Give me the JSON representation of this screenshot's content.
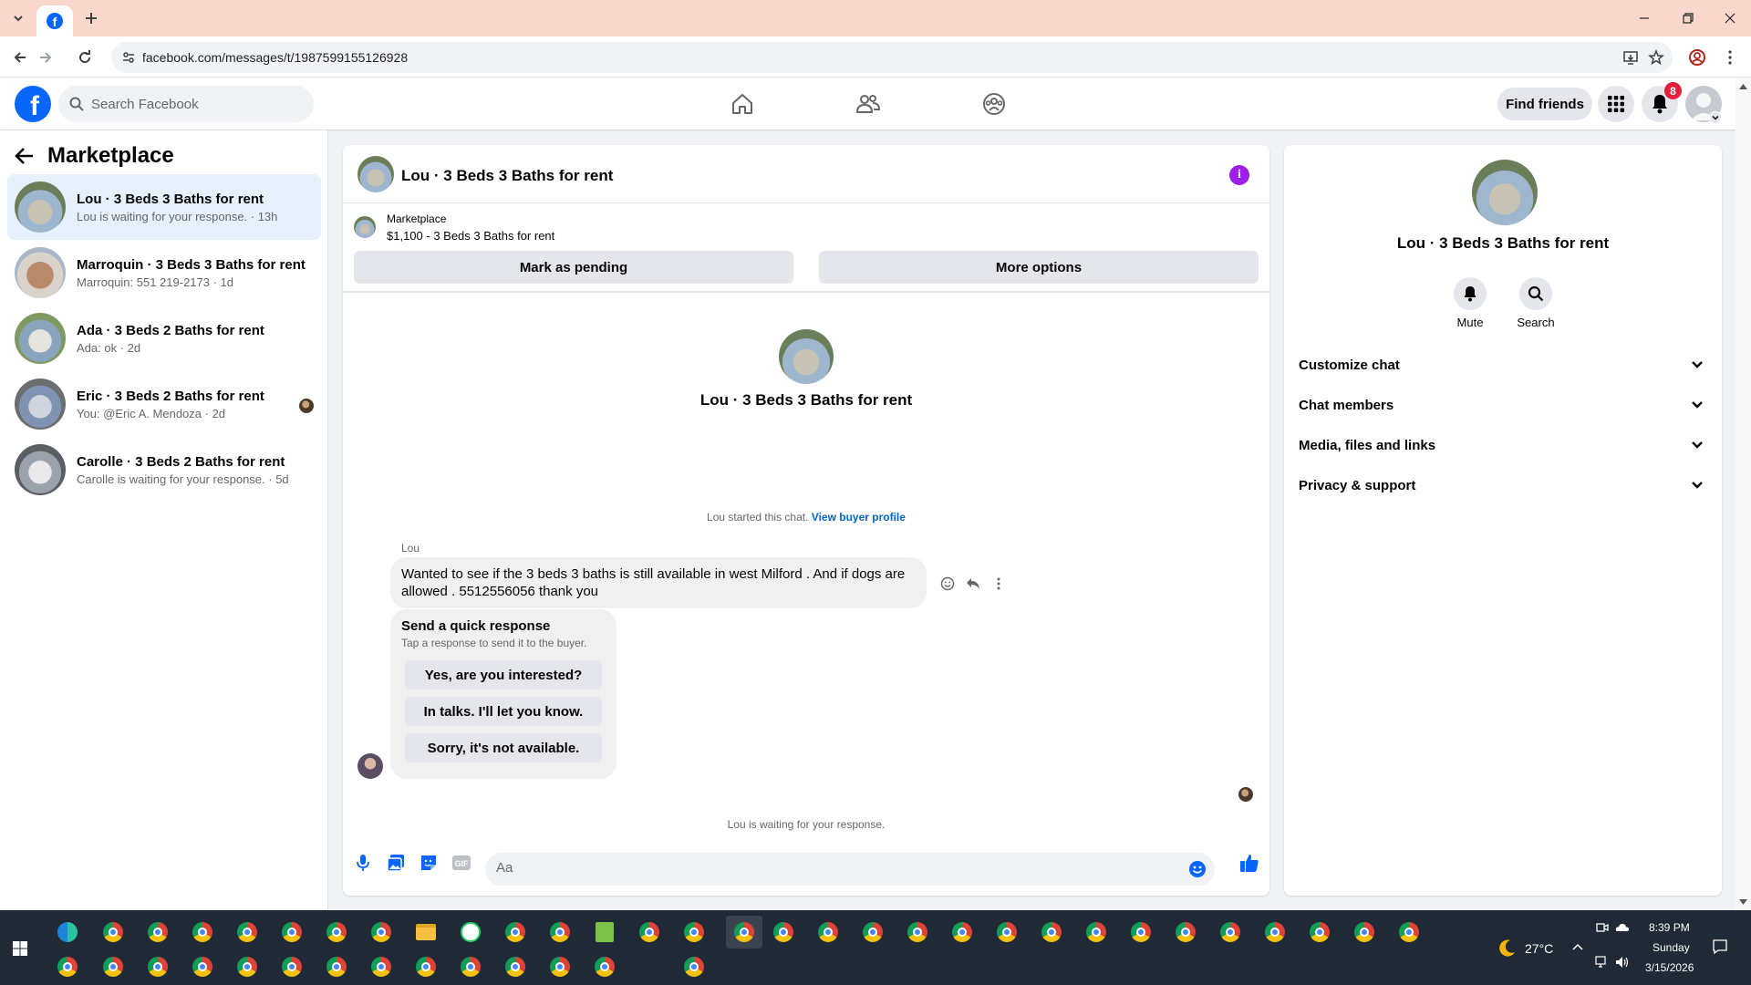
{
  "browser": {
    "url": "facebook.com/messages/t/1987599155126928",
    "tab_icon": "facebook-icon",
    "accent": "#f9d7cc"
  },
  "header": {
    "search_placeholder": "Search Facebook",
    "find_friends_label": "Find friends",
    "notification_count": "8",
    "brand_color": "#0866ff"
  },
  "left_panel": {
    "title": "Marketplace",
    "conversations": [
      {
        "title": "Lou · 3 Beds 3 Baths for rent",
        "subtitle": "Lou is waiting for your response. · 13h",
        "active": true
      },
      {
        "title": "Marroquin · 3 Beds 3 Baths for rent",
        "subtitle": "Marroquin: 551 219-2173 · 1d"
      },
      {
        "title": "Ada · 3 Beds 2 Baths for rent",
        "subtitle": "Ada: ok · 2d"
      },
      {
        "title": "Eric · 3 Beds 2 Baths for rent",
        "subtitle": "You: @Eric A. Mendoza · 2d"
      },
      {
        "title": "Carolle · 3 Beds 2 Baths for rent",
        "subtitle": "Carolle is waiting for your response. · 5d"
      }
    ]
  },
  "chat": {
    "title": "Lou · 3 Beds 3 Baths for rent",
    "listing": {
      "label": "Marketplace",
      "price_title": "$1,100 - 3 Beds 3 Baths for rent",
      "mark_pending_label": "Mark as pending",
      "more_options_label": "More options"
    },
    "intro_title": "Lou · 3 Beds 3 Baths for rent",
    "started_text": "Lou started this chat.",
    "view_profile_link": "View buyer profile",
    "sender_name": "Lou",
    "message_text": "Wanted to see if the 3 beds 3 baths is still available in west Milford . And if dogs are allowed . 5512556056 thank you",
    "quick_response": {
      "title": "Send a quick response",
      "subtitle": "Tap a response to send it to the buyer.",
      "options": [
        "Yes, are you interested?",
        "In talks. I'll let you know.",
        "Sorry, it's not available."
      ]
    },
    "waiting_text": "Lou is waiting for your response.",
    "composer_placeholder": "Aa"
  },
  "right_panel": {
    "title": "Lou · 3 Beds 3 Baths for rent",
    "actions": [
      {
        "label": "Mute",
        "icon": "bell-icon"
      },
      {
        "label": "Search",
        "icon": "search-icon"
      }
    ],
    "sections": [
      "Customize chat",
      "Chat members",
      "Media, files and links",
      "Privacy & support"
    ]
  },
  "taskbar": {
    "temperature": "27°C",
    "time": "8:39 PM",
    "day": "Sunday",
    "date": "3/15/2026"
  }
}
